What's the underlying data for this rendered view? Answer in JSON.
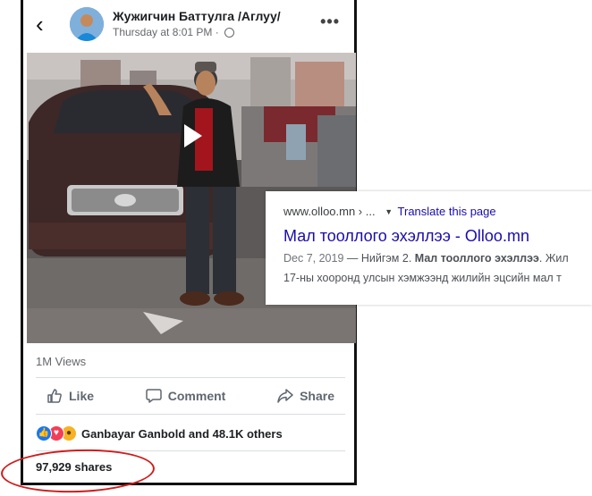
{
  "post": {
    "author": "Жужигчин Баттулга /Аглуу/",
    "timestamp": "Thursday at 8:01 PM",
    "timestamp_sep": "·",
    "back_glyph": "‹",
    "more_glyph": "•••",
    "views": "1M Views",
    "actions": {
      "like": "Like",
      "comment": "Comment",
      "share": "Share"
    },
    "reactions_text": "Ganbayar Ganbold and 48.1K others",
    "reaction_icons": [
      "like-icon",
      "love-icon",
      "wow-icon"
    ],
    "shares": "97,929 shares"
  },
  "search_result": {
    "url": "www.olloo.mn › ...",
    "translate": "Translate this page",
    "title": "Мал тооллого эхэллээ - Olloo.mn",
    "snippet_date": "Dec 7, 2019",
    "snippet_sep": " — Нийгэм 2. ",
    "snippet_bold": "Мал тооллого эхэллээ",
    "snippet_rest": ". Жил",
    "snippet_line2": "17-ны хооронд улсын хэмжээнд жилийн эцсийн мал т"
  },
  "colors": {
    "link_blue": "#1a0dab",
    "fb_blue": "#1877f2",
    "annotation_red": "#d11c1c"
  }
}
